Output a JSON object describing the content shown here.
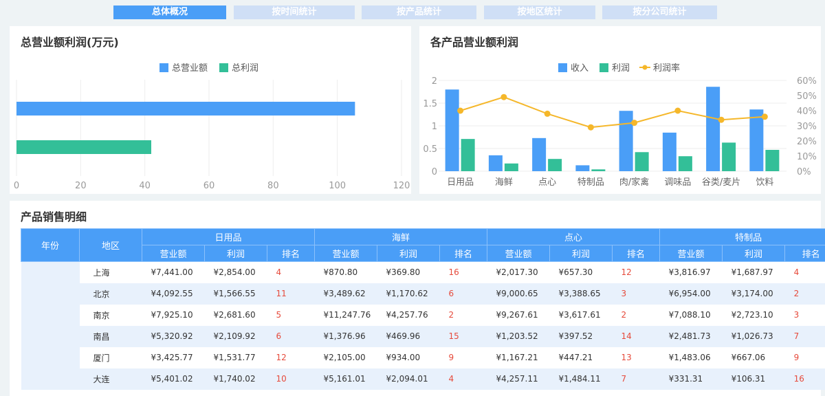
{
  "tabs": [
    "总体概况",
    "按时间统计",
    "按产品统计",
    "按地区统计",
    "按分公司统计"
  ],
  "left_panel": {
    "title": "总营业额利润(万元)"
  },
  "right_panel": {
    "title": "各产品营业额利润"
  },
  "table_panel": {
    "title": "产品销售明细"
  },
  "colors": {
    "revenue": "#4a9ef7",
    "profit": "#33bf98",
    "rate": "#f5b72a",
    "tab_active": "#4a9ef7",
    "tab_inactive": "#cfdff6"
  },
  "chart_data": [
    {
      "type": "bar",
      "orientation": "horizontal",
      "title": "总营业额利润(万元)",
      "series": [
        {
          "name": "总营业额",
          "values": [
            105.5
          ]
        },
        {
          "name": "总利润",
          "values": [
            42
          ]
        }
      ],
      "xlim": [
        0,
        120
      ],
      "xticks": [
        "0",
        "20",
        "40",
        "60",
        "80",
        "100",
        "120"
      ],
      "legend": "top"
    },
    {
      "type": "bar",
      "title": "各产品营业额利润",
      "categories": [
        "日用品",
        "海鲜",
        "点心",
        "特制品",
        "肉/家禽",
        "调味品",
        "谷类/麦片",
        "饮料"
      ],
      "series": [
        {
          "name": "收入",
          "values": [
            1.8,
            0.35,
            0.73,
            0.13,
            1.33,
            0.85,
            1.86,
            1.36
          ]
        },
        {
          "name": "利润",
          "values": [
            0.71,
            0.17,
            0.27,
            0.04,
            0.42,
            0.33,
            0.63,
            0.47
          ]
        },
        {
          "name": "利润率",
          "type": "line",
          "axis": "right",
          "values": [
            40,
            49,
            38,
            29,
            32,
            40,
            34,
            36
          ]
        }
      ],
      "ylim": [
        0,
        2
      ],
      "yticks": [
        "0",
        "0.5",
        "1",
        "1.5",
        "2"
      ],
      "y2lim": [
        0,
        60
      ],
      "y2ticks": [
        "0%",
        "10%",
        "20%",
        "30%",
        "40%",
        "50%",
        "60%"
      ],
      "legend": "top"
    }
  ],
  "table": {
    "col_year": "年份",
    "col_region": "地区",
    "groups": [
      "日用品",
      "海鲜",
      "点心",
      "特制品"
    ],
    "sub": [
      "营业额",
      "利润",
      "排名"
    ],
    "rows": [
      [
        "上海",
        "¥7,441.00",
        "¥2,854.00",
        "4",
        "¥870.80",
        "¥369.80",
        "16",
        "¥2,017.30",
        "¥657.30",
        "12",
        "¥3,816.97",
        "¥1,687.97",
        "4"
      ],
      [
        "北京",
        "¥4,092.55",
        "¥1,566.55",
        "11",
        "¥3,489.62",
        "¥1,170.62",
        "6",
        "¥9,000.65",
        "¥3,388.65",
        "3",
        "¥6,954.00",
        "¥3,174.00",
        "2"
      ],
      [
        "南京",
        "¥7,925.10",
        "¥2,681.60",
        "5",
        "¥11,247.76",
        "¥4,257.76",
        "2",
        "¥9,267.61",
        "¥3,617.61",
        "2",
        "¥7,088.10",
        "¥2,723.10",
        "3"
      ],
      [
        "南昌",
        "¥5,320.92",
        "¥2,109.92",
        "6",
        "¥1,376.96",
        "¥469.96",
        "15",
        "¥1,203.52",
        "¥397.52",
        "14",
        "¥2,481.73",
        "¥1,026.73",
        "7"
      ],
      [
        "厦门",
        "¥3,425.77",
        "¥1,531.77",
        "12",
        "¥2,105.00",
        "¥934.00",
        "9",
        "¥1,167.21",
        "¥447.21",
        "13",
        "¥1,483.06",
        "¥667.06",
        "9"
      ],
      [
        "大连",
        "¥5,401.02",
        "¥1,740.02",
        "10",
        "¥5,161.01",
        "¥2,094.01",
        "4",
        "¥4,257.11",
        "¥1,484.11",
        "7",
        "¥331.31",
        "¥106.31",
        "16"
      ]
    ]
  }
}
